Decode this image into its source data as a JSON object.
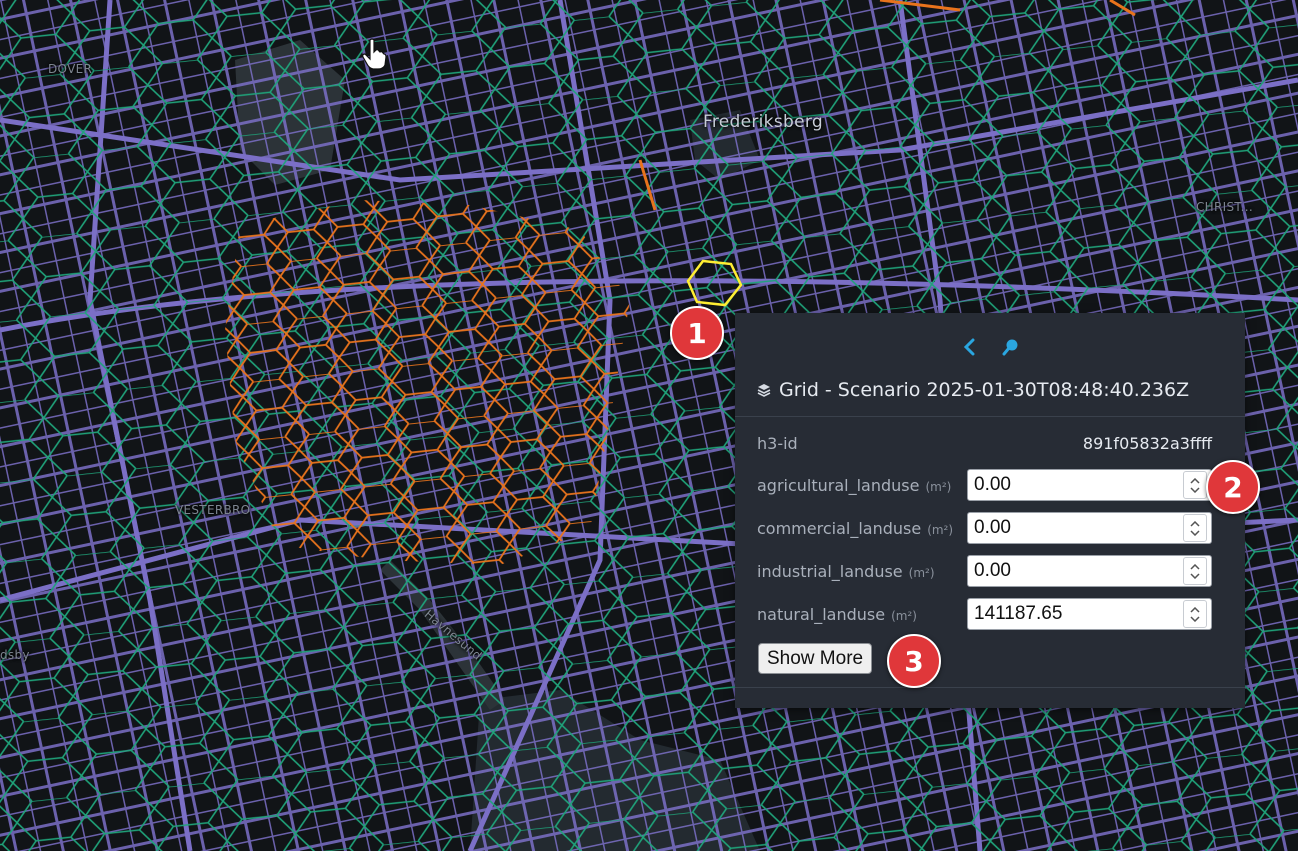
{
  "map": {
    "labels": {
      "frederiksberg": "Frederiksberg",
      "dover": "DOVER",
      "ludsby": "dsby",
      "christianshavn": "CHRIST...",
      "havnesund": "Havnesund",
      "west": "VESTERBRO"
    },
    "colors": {
      "background": "#111417",
      "roads": "#7b6fc6",
      "hex_default": "#1fa37a",
      "hex_highlight": "#e8731c",
      "hex_selected": "#ffee33",
      "water": "#2c3338"
    }
  },
  "panel": {
    "title": "Grid - Scenario 2025-01-30T08:48:40.236Z",
    "icons": {
      "back": "chevron-left-icon",
      "pin": "pin-icon",
      "layers": "layers-icon"
    },
    "h3_label": "h3-id",
    "h3_value": "891f05832a3ffff",
    "fields": [
      {
        "label": "agricultural_landuse",
        "unit": "(m²)",
        "value": "0.00"
      },
      {
        "label": "commercial_landuse",
        "unit": "(m²)",
        "value": "0.00"
      },
      {
        "label": "industrial_landuse",
        "unit": "(m²)",
        "value": "0.00"
      },
      {
        "label": "natural_landuse",
        "unit": "(m²)",
        "value": "141187.65"
      }
    ],
    "show_more_label": "Show More"
  },
  "callouts": [
    "1",
    "2",
    "3"
  ]
}
